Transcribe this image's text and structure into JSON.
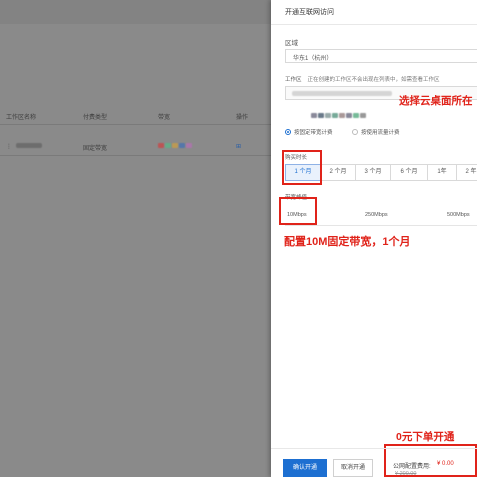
{
  "background": {
    "table_headers": [
      "工作区名称",
      "付费类型",
      "带宽",
      "操作"
    ],
    "row": {
      "type": "固定带宽",
      "action_icon": "grid-icon"
    }
  },
  "drawer": {
    "title": "开通互联网访问",
    "region_label": "区域",
    "region_value": "华东1（杭州）",
    "workspace_label": "工作区",
    "workspace_hint": "正在创建的工作区不会出现在列表中，如需查看工作区",
    "billing_options": [
      "按固定带宽计费",
      "按使用流量计费"
    ],
    "duration_label": "购买时长",
    "durations": [
      "1 个月",
      "2 个月",
      "3 个月",
      "6 个月",
      "1年",
      "2 年"
    ],
    "active_duration": "1 个月",
    "bandwidth_label": "带宽峰值",
    "bandwidths": [
      "10Mbps",
      "250Mbps",
      "500Mbps"
    ],
    "active_bandwidth": "10Mbps",
    "confirm_button": "确认开通",
    "cancel_button": "取消开通",
    "fee_label": "公网配置费用:",
    "fee_value": "¥ 0.00",
    "fee_original": "¥ 200.00"
  },
  "annotations": {
    "select_workspace": "选择云桌面所在",
    "config_bandwidth": "配置10M固定带宽，1个月",
    "zero_order": "0元下单开通"
  },
  "colors": {
    "accent": "#1d6fd1",
    "annotation_red": "#e0231a",
    "overlay": "#8a8a8a"
  }
}
